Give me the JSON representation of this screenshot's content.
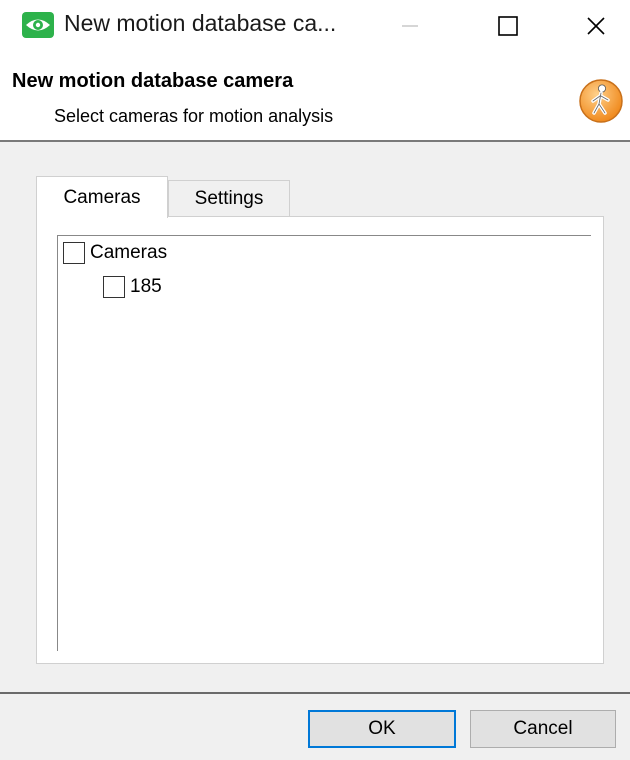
{
  "window": {
    "title": "New motion database ca...",
    "icon": "eye-icon",
    "controls": [
      "minimize-icon",
      "maximize-icon",
      "close-icon"
    ]
  },
  "header": {
    "title": "New motion database camera",
    "subtitle": "Select cameras for motion analysis",
    "icon": "walking-person-icon"
  },
  "tabs": [
    {
      "label": "Cameras",
      "selected": true
    },
    {
      "label": "Settings",
      "selected": false
    }
  ],
  "tree": {
    "root": {
      "label": "Cameras",
      "checked": false
    },
    "children": [
      {
        "label": "185",
        "checked": false
      }
    ]
  },
  "footer": {
    "ok_label": "OK",
    "cancel_label": "Cancel"
  },
  "colors": {
    "accent": "#0078d7",
    "app_icon_green": "#2db24b",
    "header_icon_orange": "#f39a36"
  }
}
